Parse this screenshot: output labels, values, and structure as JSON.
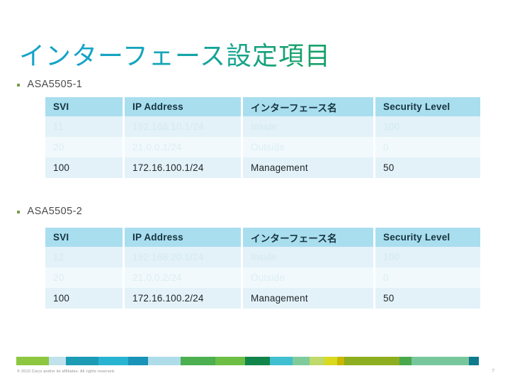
{
  "slide": {
    "title": "インターフェース設定項目",
    "title_gradient_start": "#15A3C7",
    "title_gradient_end": "#17A06A",
    "background": "#FFFFFF"
  },
  "sections": [
    {
      "bullet_label": "ASA5505-1",
      "table": {
        "headers": [
          "SVI",
          "IP Address",
          "インターフェース名",
          "Security Level"
        ],
        "header_bg": "#A9DEEF",
        "rows": [
          {
            "state": "faded",
            "cells": [
              "11",
              "192.168.10.1/24",
              "Inside",
              "100"
            ]
          },
          {
            "state": "faded",
            "cells": [
              "20",
              "21.0.0.1/24",
              "Outside",
              "0"
            ]
          },
          {
            "state": "active",
            "cells": [
              "100",
              "172.16.100.1/24",
              "Management",
              "50"
            ]
          }
        ]
      }
    },
    {
      "bullet_label": "ASA5505-2",
      "table": {
        "headers": [
          "SVI",
          "IP Address",
          "インターフェース名",
          "Security Level"
        ],
        "header_bg": "#A9DEEF",
        "rows": [
          {
            "state": "faded",
            "cells": [
              "12",
              "192.168.20.1/24",
              "Inside",
              "100"
            ]
          },
          {
            "state": "faded",
            "cells": [
              "20",
              "21.0.0.2/24",
              "Outside",
              "0"
            ]
          },
          {
            "state": "active",
            "cells": [
              "100",
              "172.16.100.2/24",
              "Management",
              "50"
            ]
          }
        ]
      }
    }
  ],
  "footer": {
    "copyright": "© 2010 Cisco and/or its affiliates. All rights reserved.",
    "page_number": "7",
    "color_bar": [
      {
        "color": "#8DC63F",
        "flex": 13
      },
      {
        "color": "#BFE2EC",
        "flex": 7
      },
      {
        "color": "#1C9BB5",
        "flex": 13
      },
      {
        "color": "#29B3D2",
        "flex": 12
      },
      {
        "color": "#1993B8",
        "flex": 8
      },
      {
        "color": "#AEDCE8",
        "flex": 13
      },
      {
        "color": "#4CAF50",
        "flex": 14
      },
      {
        "color": "#6CBE45",
        "flex": 12
      },
      {
        "color": "#12854A",
        "flex": 10
      },
      {
        "color": "#3FBFCF",
        "flex": 9
      },
      {
        "color": "#7FCB9B",
        "flex": 7
      },
      {
        "color": "#BFD96B",
        "flex": 6
      },
      {
        "color": "#D9D920",
        "flex": 5
      },
      {
        "color": "#C8B800",
        "flex": 3
      },
      {
        "color": "#8DAE1E",
        "flex": 22
      },
      {
        "color": "#49A84B",
        "flex": 5
      },
      {
        "color": "#78C79C",
        "flex": 23
      },
      {
        "color": "#0E7A8C",
        "flex": 4
      },
      {
        "color": "#FFFFFF",
        "flex": 6
      }
    ]
  }
}
